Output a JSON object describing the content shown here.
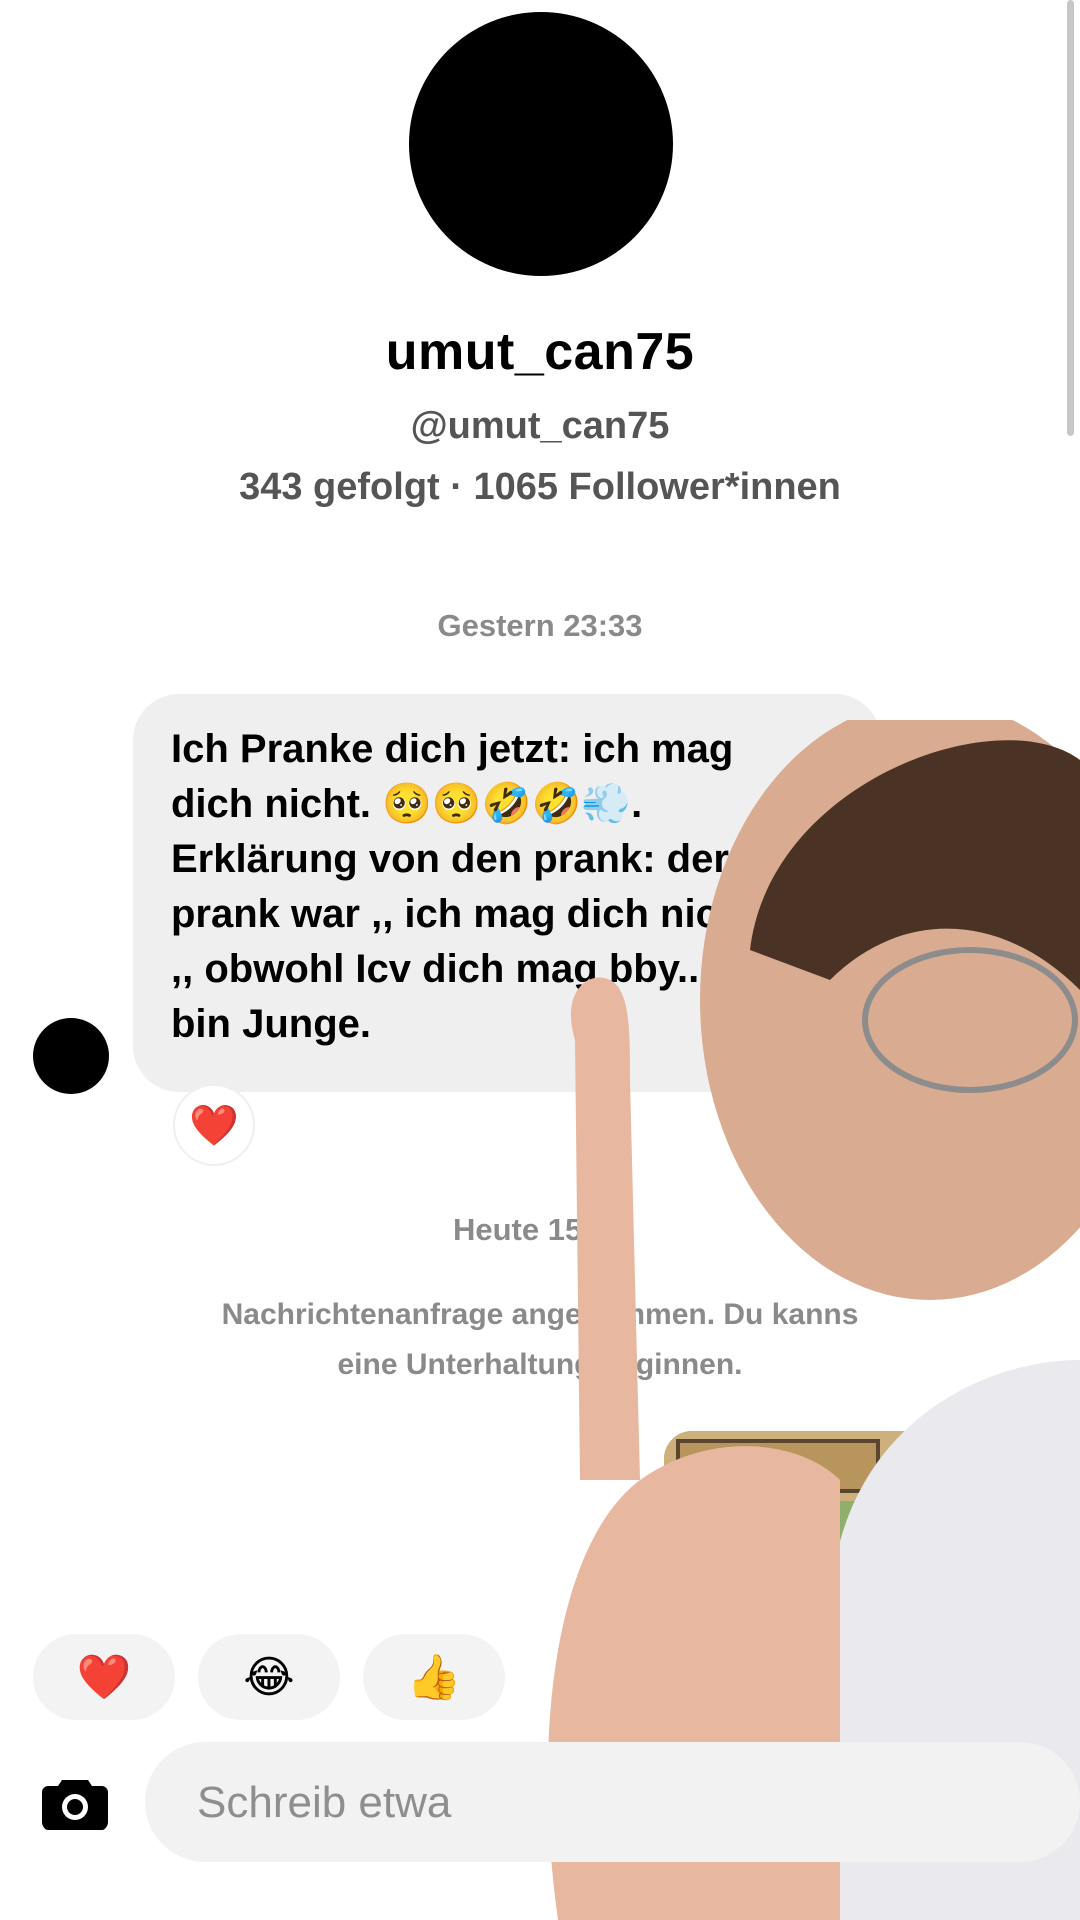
{
  "profile": {
    "display_name": "umut_can75",
    "handle": "@umut_can75",
    "stats": "343 gefolgt · 1065 Follower*innen"
  },
  "conversation": {
    "timestamp_1": "Gestern 23:33",
    "message": {
      "line1": "Ich Pranke dich jetzt: ich mag",
      "line2": "dich nicht. 🥺🥺🤣🤣💨.",
      "line3": "Erklärung von den prank: der",
      "line4": "prank war ,, ich mag dich nicht",
      "line5": ",, obwohl Icv dich mag bby..",
      "line6": "bin Junge.",
      "reaction": "❤️"
    },
    "timestamp_2": "Heute 15:31",
    "system_note_line1": "Nachrichtenanfrage angenommen. Du kanns",
    "system_note_line2": "eine Unterhaltung beginnen."
  },
  "quick_reactions": [
    "❤️",
    "😂",
    "👍"
  ],
  "composer": {
    "placeholder": "Schreib etwa"
  },
  "icons": {
    "camera": "camera-icon",
    "avatar": "avatar"
  },
  "colors": {
    "bubble_bg": "#efefef",
    "muted_text": "#8a8a8a",
    "composer_bg": "#f2f2f2"
  }
}
